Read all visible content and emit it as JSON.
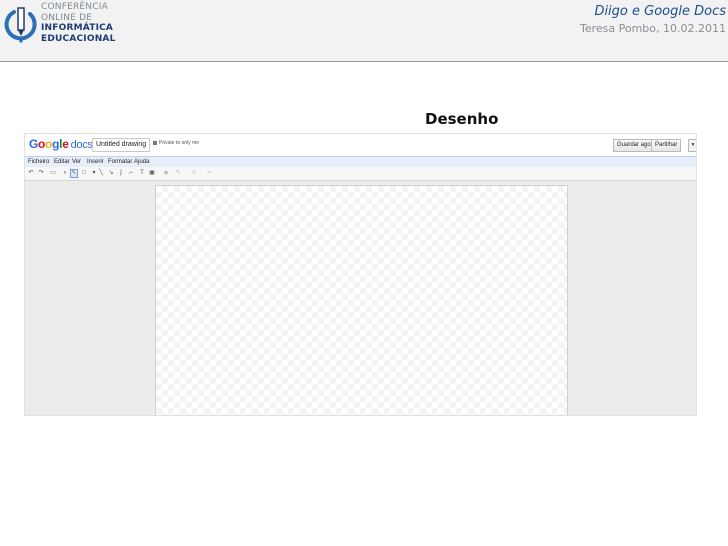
{
  "slide": {
    "logo": {
      "lines": [
        "CONFERÊNCIA",
        "ONLINE DE",
        "INFORMÁTICA",
        "EDUCACIONAL"
      ]
    },
    "title": "Diigo e Google Docs",
    "subtitle": "Teresa Pombo, 10.02.2011",
    "section_heading": "Desenho",
    "colors": {
      "header_bg": "#f2f2f2",
      "title": "#1f4e8f",
      "logo_dark": "#1f3b73"
    }
  },
  "gdocs": {
    "logo_letters": [
      "G",
      "o",
      "o",
      "g",
      "l",
      "e"
    ],
    "logo_product": "docs",
    "document_name": "Untitled drawing",
    "privacy": "Private to only me",
    "buttons": {
      "save": "Guardar agora",
      "share": "Partilhar"
    },
    "menu": [
      "Ficheiro",
      "Editar",
      "Ver",
      "Inserir",
      "Formatar",
      "Ajuda"
    ],
    "toolbar_icons": [
      "undo-icon",
      "redo-icon",
      "print-icon",
      "zoom-icon",
      "select-icon",
      "shape-icon",
      "line-icon",
      "arrow-icon",
      "curve-icon",
      "polyline-icon",
      "text-icon",
      "image-icon",
      "fill-color-icon",
      "line-color-icon",
      "line-weight-icon",
      "line-dash-icon"
    ]
  }
}
